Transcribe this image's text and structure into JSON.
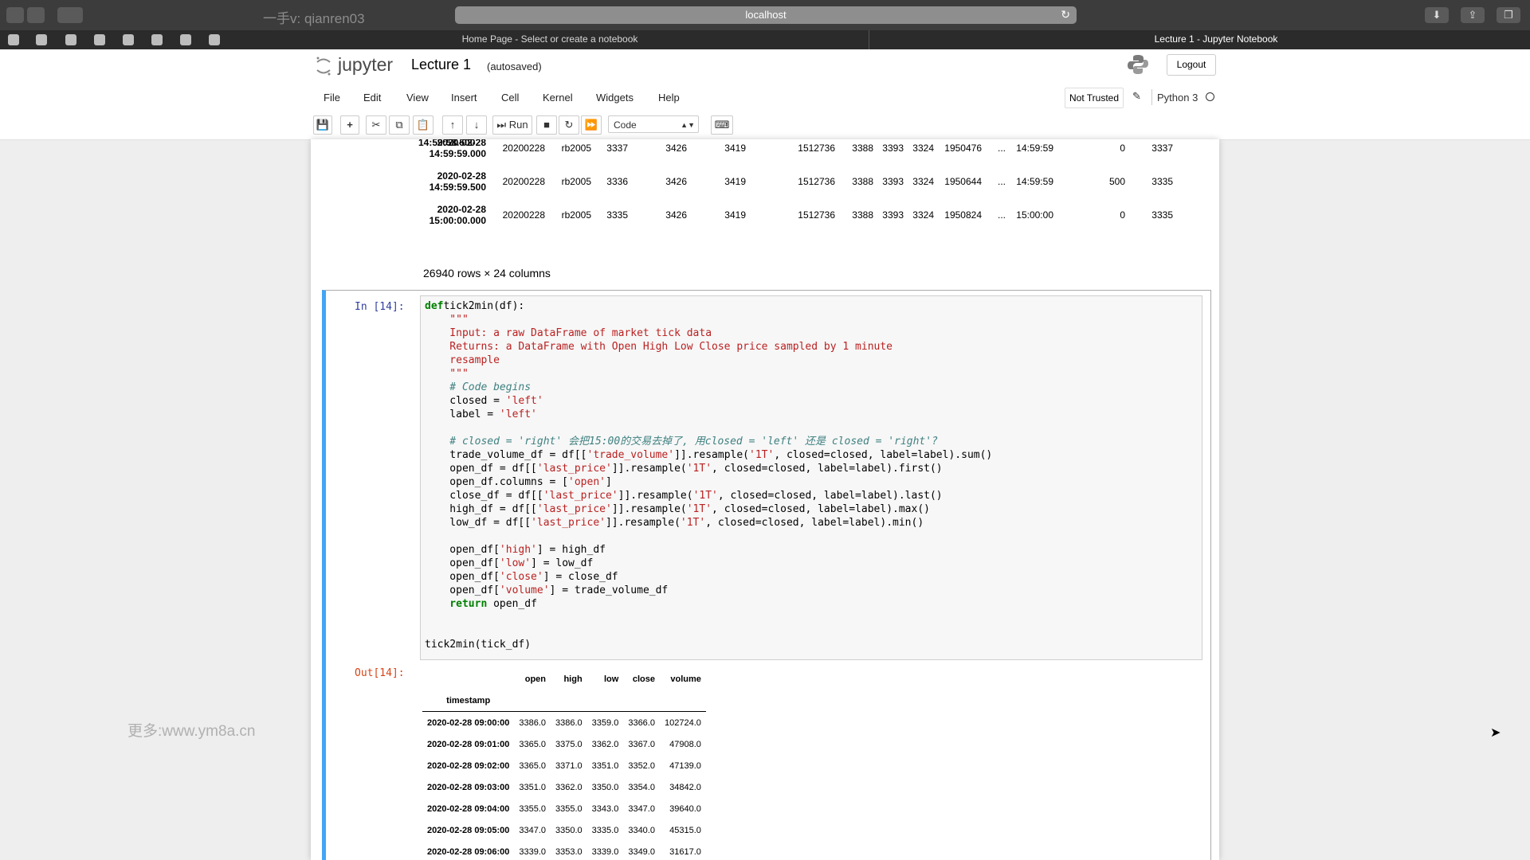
{
  "browser": {
    "window_title": "一手v: qianren03",
    "url": "localhost",
    "tabs": [
      "Home Page - Select or create a notebook",
      "Lecture 1 - Jupyter Notebook"
    ]
  },
  "jupyter": {
    "logo_text": "jupyter",
    "notebook_name": "Lecture 1",
    "autosave": "(autosaved)",
    "logout": "Logout",
    "menu": [
      "File",
      "Edit",
      "View",
      "Insert",
      "Cell",
      "Kernel",
      "Widgets",
      "Help"
    ],
    "trust": "Not Trusted",
    "kernel": "Python 3",
    "toolbar": {
      "run_label": "Run",
      "cell_type": "Code"
    }
  },
  "prev_output": {
    "rows": [
      {
        "index": [
          "2020-02-28",
          "14:59:59.000"
        ],
        "cells": [
          "20200228",
          "rb2005",
          "3337",
          "3426",
          "3419",
          "1512736",
          "3388",
          "3393",
          "3324",
          "1950476",
          "...",
          "14:59:59",
          "0",
          "3337"
        ]
      },
      {
        "index": [
          "2020-02-28",
          "14:59:59.500"
        ],
        "cells": [
          "20200228",
          "rb2005",
          "3336",
          "3426",
          "3419",
          "1512736",
          "3388",
          "3393",
          "3324",
          "1950644",
          "...",
          "14:59:59",
          "500",
          "3335"
        ]
      },
      {
        "index": [
          "2020-02-28",
          "15:00:00.000"
        ],
        "cells": [
          "20200228",
          "rb2005",
          "3335",
          "3426",
          "3419",
          "1512736",
          "3388",
          "3393",
          "3324",
          "1950824",
          "...",
          "15:00:00",
          "0",
          "3335"
        ]
      }
    ],
    "partial_index": "14:59:58.500",
    "summary": "26940 rows × 24 columns"
  },
  "cell": {
    "in_prompt": "In [14]:",
    "out_prompt": "Out[14]:",
    "code_lines": [
      [
        [
          "kw",
          "def"
        ],
        [
          "",
          "tick2min(df):"
        ]
      ],
      [
        [
          "st",
          "    \"\"\""
        ]
      ],
      [
        [
          "st",
          "    Input: a raw DataFrame of market tick data"
        ]
      ],
      [
        [
          "st",
          "    Returns: a DataFrame with Open High Low Close price sampled by 1 minute"
        ]
      ],
      [
        [
          "st",
          "    resample"
        ]
      ],
      [
        [
          "st",
          "    \"\"\""
        ]
      ],
      [
        [
          "cm",
          "    # Code begins"
        ]
      ],
      [
        [
          "",
          "    closed = "
        ],
        [
          "st",
          "'left'"
        ]
      ],
      [
        [
          "",
          "    label = "
        ],
        [
          "st",
          "'left'"
        ]
      ],
      [
        [
          "",
          "    "
        ]
      ],
      [
        [
          "cm",
          "    # closed = 'right' 会把15:00的交易去掉了, 用closed = 'left' 还是 closed = 'right'?"
        ]
      ],
      [
        [
          "",
          "    trade_volume_df = df[["
        ],
        [
          "st",
          "'trade_volume'"
        ],
        [
          "",
          "]].resample("
        ],
        [
          "st",
          "'1T'"
        ],
        [
          "",
          ", closed=closed, label=label).sum()"
        ]
      ],
      [
        [
          "",
          "    open_df = df[["
        ],
        [
          "st",
          "'last_price'"
        ],
        [
          "",
          "]].resample("
        ],
        [
          "st",
          "'1T'"
        ],
        [
          "",
          ", closed=closed, label=label).first()"
        ]
      ],
      [
        [
          "",
          "    open_df.columns = ["
        ],
        [
          "st",
          "'open'"
        ],
        [
          "",
          "]"
        ]
      ],
      [
        [
          "",
          "    close_df = df[["
        ],
        [
          "st",
          "'last_price'"
        ],
        [
          "",
          "]].resample("
        ],
        [
          "st",
          "'1T'"
        ],
        [
          "",
          ", closed=closed, label=label).last()"
        ]
      ],
      [
        [
          "",
          "    high_df = df[["
        ],
        [
          "st",
          "'last_price'"
        ],
        [
          "",
          "]].resample("
        ],
        [
          "st",
          "'1T'"
        ],
        [
          "",
          ", closed=closed, label=label).max()"
        ]
      ],
      [
        [
          "",
          "    low_df = df[["
        ],
        [
          "st",
          "'last_price'"
        ],
        [
          "",
          "]].resample("
        ],
        [
          "st",
          "'1T'"
        ],
        [
          "",
          ", closed=closed, label=label).min()"
        ]
      ],
      [
        [
          "",
          "    "
        ]
      ],
      [
        [
          "",
          "    open_df["
        ],
        [
          "st",
          "'high'"
        ],
        [
          "",
          "] = high_df"
        ]
      ],
      [
        [
          "",
          "    open_df["
        ],
        [
          "st",
          "'low'"
        ],
        [
          "",
          "] = low_df"
        ]
      ],
      [
        [
          "",
          "    open_df["
        ],
        [
          "st",
          "'close'"
        ],
        [
          "",
          "] = close_df"
        ]
      ],
      [
        [
          "",
          "    open_df["
        ],
        [
          "st",
          "'volume'"
        ],
        [
          "",
          "] = trade_volume_df"
        ]
      ],
      [
        [
          "kw",
          "    return"
        ],
        [
          "",
          " open_df"
        ]
      ],
      [
        [
          "",
          "    "
        ]
      ],
      [
        [
          "",
          "    "
        ]
      ],
      [
        [
          "",
          "tick2min(tick_df)"
        ]
      ]
    ]
  },
  "result_table": {
    "columns": [
      "open",
      "high",
      "low",
      "close",
      "volume"
    ],
    "index_name": "timestamp",
    "rows": [
      [
        "2020-02-28 09:00:00",
        "3386.0",
        "3386.0",
        "3359.0",
        "3366.0",
        "102724.0"
      ],
      [
        "2020-02-28 09:01:00",
        "3365.0",
        "3375.0",
        "3362.0",
        "3367.0",
        "47908.0"
      ],
      [
        "2020-02-28 09:02:00",
        "3365.0",
        "3371.0",
        "3351.0",
        "3352.0",
        "47139.0"
      ],
      [
        "2020-02-28 09:03:00",
        "3351.0",
        "3362.0",
        "3350.0",
        "3354.0",
        "34842.0"
      ],
      [
        "2020-02-28 09:04:00",
        "3355.0",
        "3355.0",
        "3343.0",
        "3347.0",
        "39640.0"
      ],
      [
        "2020-02-28 09:05:00",
        "3347.0",
        "3350.0",
        "3335.0",
        "3340.0",
        "45315.0"
      ],
      [
        "2020-02-28 09:06:00",
        "3339.0",
        "3353.0",
        "3339.0",
        "3349.0",
        "31617.0"
      ]
    ]
  },
  "watermark": "更多:www.ym8a.cn"
}
